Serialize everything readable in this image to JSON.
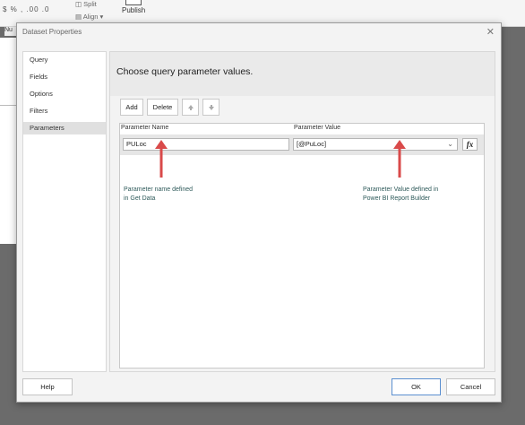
{
  "ribbon": {
    "number_format": "$  %  ,  .00  .0",
    "split_label": "Split",
    "align_label": "Align",
    "publish_label": "Publish",
    "num_label": "Nu"
  },
  "dialog": {
    "title": "Dataset Properties",
    "close_glyph": "✕",
    "nav": [
      "Query",
      "Fields",
      "Options",
      "Filters",
      "Parameters"
    ],
    "selected_nav": "Parameters",
    "heading": "Choose query parameter values.",
    "toolbar": {
      "add_label": "Add",
      "delete_label": "Delete",
      "up_icon": "arrow-up-icon",
      "down_icon": "arrow-down-icon"
    },
    "grid": {
      "columns": [
        "Parameter Name",
        "Parameter Value"
      ],
      "rows": [
        {
          "name": "PULoc",
          "value": "[@PuLoc]"
        }
      ],
      "expression_button": "fx"
    },
    "annotations": {
      "left_line1": "Parameter name defined",
      "left_line2": "in Get Data",
      "right_line1": "Parameter Value defined in",
      "right_line2": "Power BI Report Builder",
      "arrow_color": "#d94a4a"
    },
    "footer": {
      "help_label": "Help",
      "ok_label": "OK",
      "cancel_label": "Cancel"
    }
  }
}
